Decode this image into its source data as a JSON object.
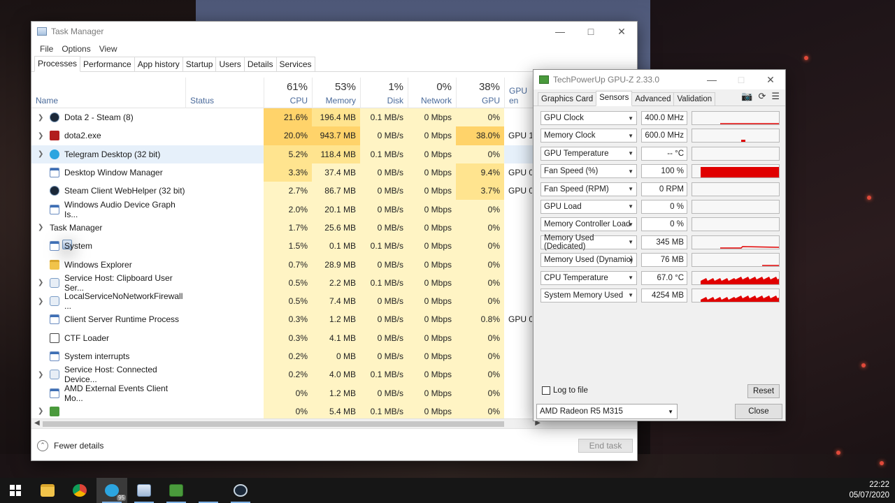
{
  "taskmanager": {
    "title": "Task Manager",
    "menu": [
      "File",
      "Options",
      "View"
    ],
    "tabs": [
      "Processes",
      "Performance",
      "App history",
      "Startup",
      "Users",
      "Details",
      "Services"
    ],
    "columns": {
      "name": "Name",
      "status": "Status",
      "cpu": {
        "pct": "61%",
        "label": "CPU"
      },
      "memory": {
        "pct": "53%",
        "label": "Memory"
      },
      "disk": {
        "pct": "1%",
        "label": "Disk"
      },
      "network": {
        "pct": "0%",
        "label": "Network"
      },
      "gpu": {
        "pct": "38%",
        "label": "GPU"
      },
      "gpu_engine": {
        "label": "GPU en"
      }
    },
    "rows": [
      {
        "name": "Dota 2 - Steam (8)",
        "cpu": "21.6%",
        "mem": "196.4 MB",
        "disk": "0.1 MB/s",
        "net": "0 Mbps",
        "gpu": "0%",
        "gpue": ""
      },
      {
        "name": "dota2.exe",
        "cpu": "20.0%",
        "mem": "943.7 MB",
        "disk": "0 MB/s",
        "net": "0 Mbps",
        "gpu": "38.0%",
        "gpue": "GPU 1 -"
      },
      {
        "name": "Telegram Desktop (32 bit)",
        "cpu": "5.2%",
        "mem": "118.4 MB",
        "disk": "0.1 MB/s",
        "net": "0 Mbps",
        "gpu": "0%",
        "gpue": ""
      },
      {
        "name": "Desktop Window Manager",
        "cpu": "3.3%",
        "mem": "37.4 MB",
        "disk": "0 MB/s",
        "net": "0 Mbps",
        "gpu": "9.4%",
        "gpue": "GPU 0 -"
      },
      {
        "name": "Steam Client WebHelper (32 bit)",
        "cpu": "2.7%",
        "mem": "86.7 MB",
        "disk": "0 MB/s",
        "net": "0 Mbps",
        "gpu": "3.7%",
        "gpue": "GPU 0 -"
      },
      {
        "name": "Windows Audio Device Graph Is...",
        "cpu": "2.0%",
        "mem": "20.1 MB",
        "disk": "0 MB/s",
        "net": "0 Mbps",
        "gpu": "0%",
        "gpue": ""
      },
      {
        "name": "Task Manager",
        "cpu": "1.7%",
        "mem": "25.6 MB",
        "disk": "0 MB/s",
        "net": "0 Mbps",
        "gpu": "0%",
        "gpue": ""
      },
      {
        "name": "System",
        "cpu": "1.5%",
        "mem": "0.1 MB",
        "disk": "0.1 MB/s",
        "net": "0 Mbps",
        "gpu": "0%",
        "gpue": ""
      },
      {
        "name": "Windows Explorer",
        "cpu": "0.7%",
        "mem": "28.9 MB",
        "disk": "0 MB/s",
        "net": "0 Mbps",
        "gpu": "0%",
        "gpue": ""
      },
      {
        "name": "Service Host: Clipboard User Ser...",
        "cpu": "0.5%",
        "mem": "2.2 MB",
        "disk": "0.1 MB/s",
        "net": "0 Mbps",
        "gpu": "0%",
        "gpue": ""
      },
      {
        "name": "LocalServiceNoNetworkFirewall ...",
        "cpu": "0.5%",
        "mem": "7.4 MB",
        "disk": "0 MB/s",
        "net": "0 Mbps",
        "gpu": "0%",
        "gpue": ""
      },
      {
        "name": "Client Server Runtime Process",
        "cpu": "0.3%",
        "mem": "1.2 MB",
        "disk": "0 MB/s",
        "net": "0 Mbps",
        "gpu": "0.8%",
        "gpue": "GPU 0 -"
      },
      {
        "name": "CTF Loader",
        "cpu": "0.3%",
        "mem": "4.1 MB",
        "disk": "0 MB/s",
        "net": "0 Mbps",
        "gpu": "0%",
        "gpue": ""
      },
      {
        "name": "System interrupts",
        "cpu": "0.2%",
        "mem": "0 MB",
        "disk": "0 MB/s",
        "net": "0 Mbps",
        "gpu": "0%",
        "gpue": ""
      },
      {
        "name": "Service Host: Connected Device...",
        "cpu": "0.2%",
        "mem": "4.0 MB",
        "disk": "0.1 MB/s",
        "net": "0 Mbps",
        "gpu": "0%",
        "gpue": ""
      },
      {
        "name": "AMD External Events Client Mo...",
        "cpu": "0%",
        "mem": "1.2 MB",
        "disk": "0 MB/s",
        "net": "0 Mbps",
        "gpu": "0%",
        "gpue": ""
      },
      {
        "name": "",
        "cpu": "0%",
        "mem": "5.4 MB",
        "disk": "0.1 MB/s",
        "net": "0 Mbps",
        "gpu": "0%",
        "gpue": ""
      }
    ],
    "fewer_details": "Fewer details",
    "end_task": "End task"
  },
  "gpuz": {
    "title": "TechPowerUp GPU-Z 2.33.0",
    "tabs": [
      "Graphics Card",
      "Sensors",
      "Advanced",
      "Validation"
    ],
    "sensors": [
      {
        "name": "GPU Clock",
        "value": "400.0 MHz"
      },
      {
        "name": "Memory Clock",
        "value": "600.0 MHz"
      },
      {
        "name": "GPU Temperature",
        "value": "-- °C"
      },
      {
        "name": "Fan Speed (%)",
        "value": "100 %"
      },
      {
        "name": "Fan Speed (RPM)",
        "value": "0 RPM"
      },
      {
        "name": "GPU Load",
        "value": "0 %"
      },
      {
        "name": "Memory Controller Load",
        "value": "0 %"
      },
      {
        "name": "Memory Used (Dedicated)",
        "value": "345 MB"
      },
      {
        "name": "Memory Used (Dynamic)",
        "value": "76 MB"
      },
      {
        "name": "CPU Temperature",
        "value": "67.0 °C"
      },
      {
        "name": "System Memory Used",
        "value": "4254 MB"
      }
    ],
    "log_to_file": "Log to file",
    "reset": "Reset",
    "device": "AMD Radeon R5 M315",
    "close": "Close"
  },
  "taskbar": {
    "time": "22:22",
    "date": "05/07/2020",
    "telegram_badge": "95"
  },
  "colors": {
    "heat_low": "#fff4c4",
    "heat_mid": "#ffe48f",
    "heat_high": "#ffd36a",
    "graph_red": "#e00000",
    "selected_row": "#e6f0fa"
  }
}
